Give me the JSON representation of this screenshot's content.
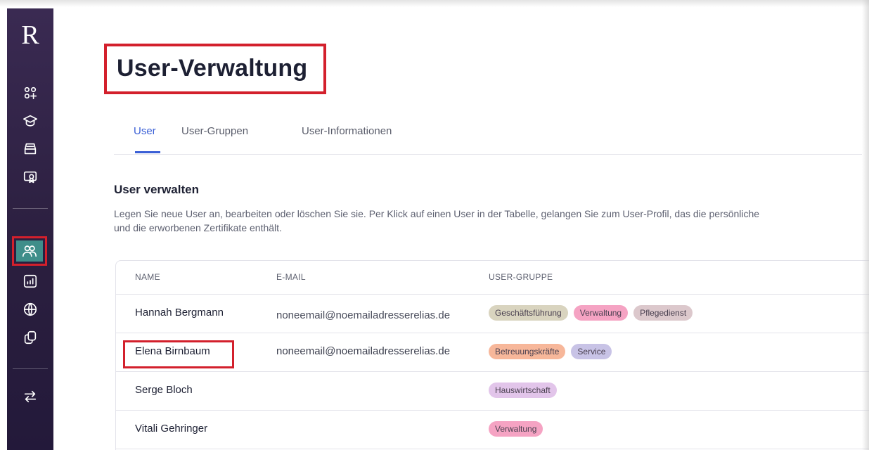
{
  "app": {
    "logo_letter": "R"
  },
  "sidebar": {
    "items": [
      {
        "icon": "dashboard-add-icon"
      },
      {
        "icon": "graduation-cap-icon"
      },
      {
        "icon": "inbox-stack-icon"
      },
      {
        "icon": "certificate-screen-icon"
      },
      {
        "icon": "users-icon",
        "active": true
      },
      {
        "icon": "chart-icon"
      },
      {
        "icon": "globe-icon"
      },
      {
        "icon": "copy-icon"
      },
      {
        "icon": "switch-icon"
      }
    ]
  },
  "page": {
    "title": "User-Verwaltung"
  },
  "tabs": [
    {
      "label": "User",
      "active": true
    },
    {
      "label": "User-Gruppen"
    },
    {
      "label": "User-Informationen"
    }
  ],
  "section": {
    "title": "User verwalten",
    "desc_line1": "Legen Sie neue User an, bearbeiten oder löschen Sie sie. Per Klick auf einen User in der Tabelle, gelangen Sie zum User-Profil, das die persönliche",
    "desc_line2": "und die erworbenen Zertifikate enthält."
  },
  "table": {
    "headers": {
      "name": "NAME",
      "email": "E-MAIL",
      "group": "USER-GRUPPE"
    },
    "rows": [
      {
        "name": "Hannah Bergmann",
        "email": "noneemail@noemailadresserelias.de",
        "groups": [
          "Geschäftsführung",
          "Verwaltung",
          "Pflegedienst"
        ]
      },
      {
        "name": "Elena Birnbaum",
        "email": "noneemail@noemailadresserelias.de",
        "groups": [
          "Betreuungskräfte",
          "Service"
        ]
      },
      {
        "name": "Serge Bloch",
        "email": "",
        "groups": [
          "Hauswirtschaft"
        ]
      },
      {
        "name": "Vitali Gehringer",
        "email": "",
        "groups": [
          "Verwaltung"
        ]
      }
    ]
  },
  "colors": {
    "accent": "#3a5fd6",
    "highlight": "#d3202c",
    "sidebar": "#2b1f3f",
    "active_nav": "#3f8e8a",
    "tag_geschaeftsfuehrung": "#d9d4bf",
    "tag_verwaltung": "#f5a3c3",
    "tag_pflegedienst": "#dcc8cc",
    "tag_betreuungskraefte": "#f7b79a",
    "tag_service": "#c8c3e6",
    "tag_hauswirtschaft": "#e2c5ea"
  }
}
